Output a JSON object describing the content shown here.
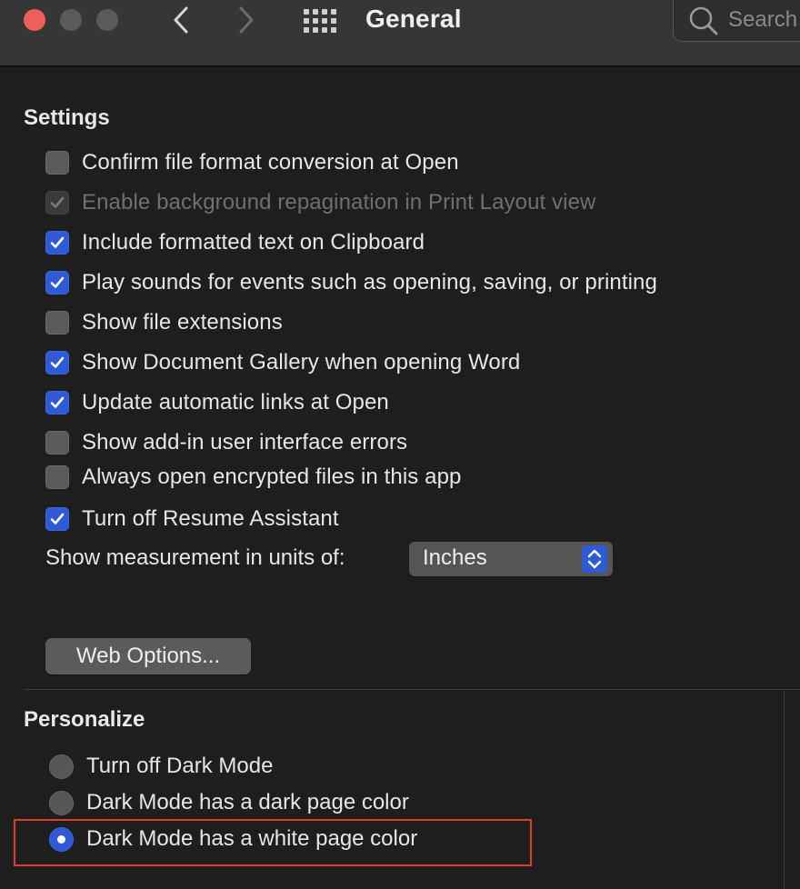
{
  "window": {
    "title": "General",
    "traffic_lights": {
      "close_color": "#ee5f57",
      "minimize_color": "#5a5a5a",
      "maximize_color": "#5a5a5a"
    }
  },
  "toolbar": {
    "back_icon": "chevron-left-icon",
    "forward_icon": "chevron-right-icon",
    "show_all_icon": "grid-icon",
    "search_placeholder": "Search"
  },
  "settings": {
    "title": "Settings",
    "options": [
      {
        "label": "Confirm file format conversion at Open",
        "checked": false,
        "enabled": true
      },
      {
        "label": "Enable background repagination in Print Layout view",
        "checked": true,
        "enabled": false
      },
      {
        "label": "Include formatted text on Clipboard",
        "checked": true,
        "enabled": true
      },
      {
        "label": "Play sounds for events such as opening, saving, or printing",
        "checked": true,
        "enabled": true
      },
      {
        "label": "Show file extensions",
        "checked": false,
        "enabled": true
      },
      {
        "label": "Show Document Gallery when opening Word",
        "checked": true,
        "enabled": true
      },
      {
        "label": "Update automatic links at Open",
        "checked": true,
        "enabled": true
      },
      {
        "label": "Show add-in user interface errors",
        "checked": false,
        "enabled": true
      },
      {
        "label": "Always open encrypted files in this app",
        "checked": false,
        "enabled": true
      },
      {
        "label": "Turn off Resume Assistant",
        "checked": true,
        "enabled": true
      }
    ],
    "units_label": "Show measurement in units of:",
    "units_value": "Inches",
    "web_options_label": "Web Options..."
  },
  "personalize": {
    "title": "Personalize",
    "options": [
      {
        "label": "Turn off Dark Mode",
        "selected": false
      },
      {
        "label": "Dark Mode has a dark page color",
        "selected": false
      },
      {
        "label": "Dark Mode has a white page color",
        "selected": true
      }
    ]
  },
  "colors": {
    "accent": "#2e5ad6",
    "highlight": "#d9402e",
    "background": "#1e1e1e",
    "titlebar": "#363636"
  }
}
